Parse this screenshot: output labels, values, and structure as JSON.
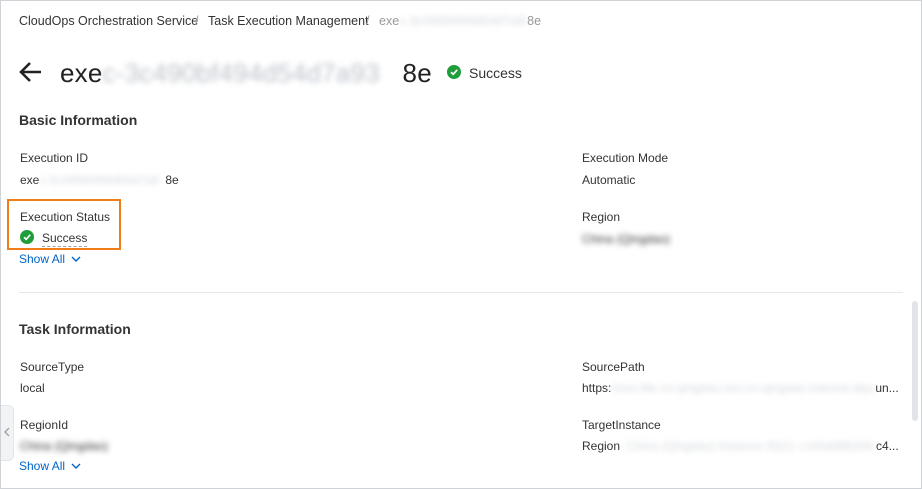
{
  "breadcrumb": {
    "items": [
      "CloudOps Orchestration Service",
      "Task Execution Management"
    ],
    "separator": "/",
    "current_prefix": "exe",
    "current_blurred": "c-3c490bf494d54d7a93",
    "current_suffix": "8e"
  },
  "header": {
    "title_prefix": "exe",
    "title_blurred": "c-3c490bf494d54d7a93",
    "title_suffix": "8e",
    "status": "Success"
  },
  "basic_info": {
    "title": "Basic Information",
    "execution_id_label": "Execution ID",
    "execution_id_prefix": "exe",
    "execution_id_blurred": "c-3c490bf494d54d7a9",
    "execution_id_suffix": "8e",
    "execution_mode_label": "Execution Mode",
    "execution_mode_value": "Automatic",
    "execution_status_label": "Execution Status",
    "execution_status_value": "Success",
    "region_label": "Region",
    "region_blurred": "China (Qingdao)",
    "show_all": "Show All"
  },
  "task_info": {
    "title": "Task Information",
    "source_type_label": "SourceType",
    "source_type_value": "local",
    "source_path_label": "SourcePath",
    "source_path_prefix": "https:",
    "source_path_blurred": "//oos-file-cn-qingdao.oss-cn-qingdao-internal.aliyuncs",
    "source_path_suffix": "un...",
    "region_id_label": "RegionId",
    "region_id_blurred": "China (Qingdao)",
    "target_instance_label": "TargetInstance",
    "target_instance_prefix": "Region",
    "target_instance_blurred": ": China (Qingdao) Instance ID(1): i-m5eb9fb2d01",
    "target_instance_suffix": "c4...",
    "show_all": "Show All"
  },
  "colors": {
    "success": "#1f9d3a",
    "link": "#0064c8",
    "highlight": "#f07d1a"
  },
  "icons": {
    "back": "arrow-left",
    "status": "check-circle",
    "expand": "chevron-down",
    "collapse_panel": "chevron-left"
  }
}
